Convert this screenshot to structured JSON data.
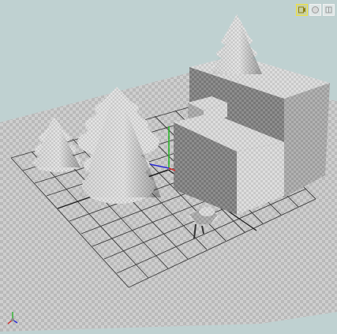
{
  "viewport": {
    "background_color": "#bfd1d1",
    "ground_color": "#c4c4c4",
    "grid_color": "#3a3a3a",
    "objects": [
      {
        "kind": "tree",
        "name": "small-tree"
      },
      {
        "kind": "tree",
        "name": "large-tree"
      },
      {
        "kind": "tree",
        "name": "hilltop-tree"
      },
      {
        "kind": "box",
        "name": "tall-block"
      },
      {
        "kind": "box",
        "name": "low-block"
      },
      {
        "kind": "box",
        "name": "small-cube"
      },
      {
        "kind": "character",
        "name": "figure"
      }
    ],
    "axes": {
      "x_color": "#d42a2a",
      "y_color": "#2ab42a",
      "z_color": "#2a2ad4"
    }
  },
  "toolbar": {
    "buttons": [
      {
        "name": "view-mode-1",
        "icon": "camera-icon",
        "active": true
      },
      {
        "name": "view-mode-2",
        "icon": "shading-icon",
        "active": false
      },
      {
        "name": "view-mode-3",
        "icon": "overlay-icon",
        "active": false
      }
    ]
  }
}
